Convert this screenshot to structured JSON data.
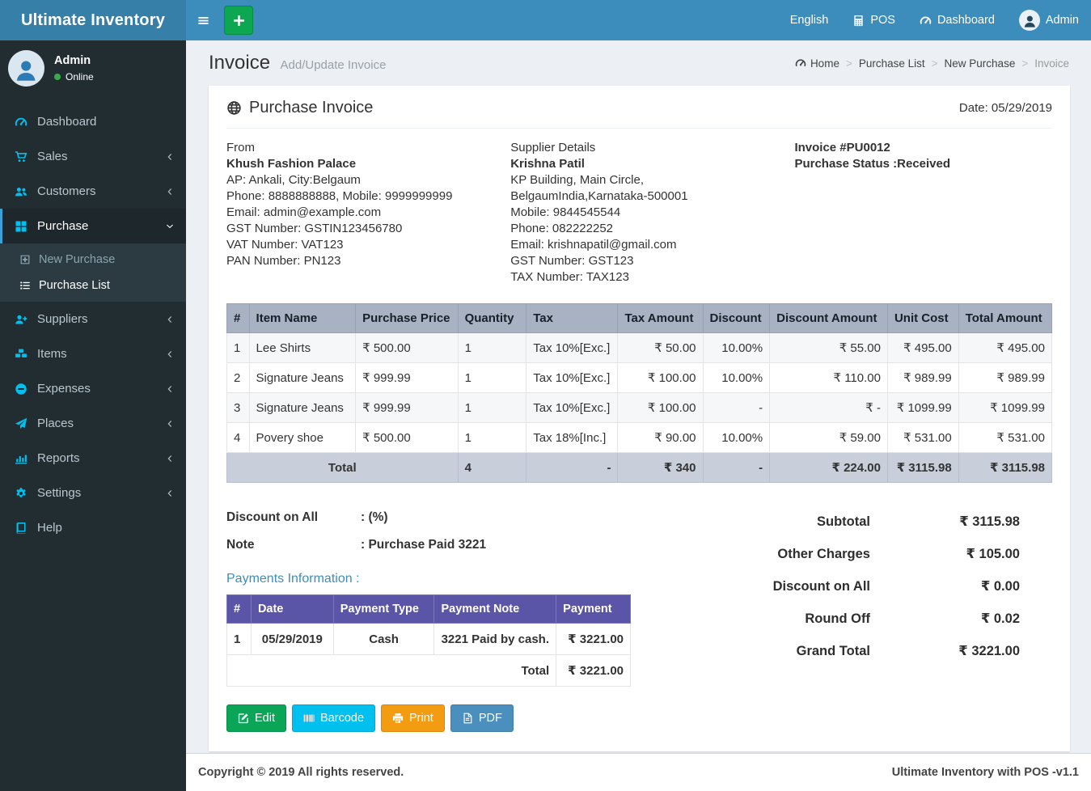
{
  "topnav": {
    "brand": "Ultimate Inventory",
    "language": "English",
    "pos": "POS",
    "dashboard": "Dashboard",
    "user": "Admin"
  },
  "sidebar": {
    "user": {
      "name": "Admin",
      "status": "Online"
    },
    "items": [
      {
        "label": "Dashboard"
      },
      {
        "label": "Sales"
      },
      {
        "label": "Customers"
      },
      {
        "label": "Purchase"
      },
      {
        "label": "New Purchase"
      },
      {
        "label": "Purchase List"
      },
      {
        "label": "Suppliers"
      },
      {
        "label": "Items"
      },
      {
        "label": "Expenses"
      },
      {
        "label": "Places"
      },
      {
        "label": "Reports"
      },
      {
        "label": "Settings"
      },
      {
        "label": "Help"
      }
    ]
  },
  "page": {
    "title": "Invoice",
    "subtitle": "Add/Update Invoice",
    "breadcrumb": [
      "Home",
      "Purchase List",
      "New Purchase",
      "Invoice"
    ]
  },
  "invoice": {
    "card_title": "Purchase Invoice",
    "date": "Date: 05/29/2019",
    "from": {
      "heading": "From",
      "name": "Khush Fashion Palace",
      "lines": [
        "AP: Ankali, City:Belgaum",
        "Phone: 8888888888, Mobile: 9999999999",
        "Email: admin@example.com",
        "GST Number: GSTIN123456780",
        "VAT Number: VAT123",
        "PAN Number: PN123"
      ]
    },
    "supplier": {
      "heading": "Supplier Details",
      "name": "Krishna Patil",
      "lines": [
        "KP Building, Main Circle, BelgaumIndia,Karnataka-500001",
        "Mobile: 9844545544",
        "Phone: 082222252",
        "Email: krishnapatil@gmail.com",
        "GST Number: GST123",
        "TAX Number: TAX123"
      ]
    },
    "meta": {
      "invoice_no": "Invoice #PU0012",
      "status": "Purchase Status :Received"
    },
    "items_table": {
      "headers": [
        "#",
        "Item Name",
        "Purchase Price",
        "Quantity",
        "Tax",
        "Tax Amount",
        "Discount",
        "Discount Amount",
        "Unit Cost",
        "Total Amount"
      ],
      "rows": [
        [
          "1",
          "Lee Shirts",
          "₹ 500.00",
          "1",
          "Tax 10%[Exc.]",
          "₹ 50.00",
          "10.00%",
          "₹ 55.00",
          "₹ 495.00",
          "₹ 495.00"
        ],
        [
          "2",
          "Signature Jeans",
          "₹ 999.99",
          "1",
          "Tax 10%[Exc.]",
          "₹ 100.00",
          "10.00%",
          "₹ 110.00",
          "₹ 989.99",
          "₹ 989.99"
        ],
        [
          "3",
          "Signature Jeans",
          "₹ 999.99",
          "1",
          "Tax 10%[Exc.]",
          "₹ 100.00",
          "-",
          "₹ -",
          "₹ 1099.99",
          "₹ 1099.99"
        ],
        [
          "4",
          "Povery shoe",
          "₹ 500.00",
          "1",
          "Tax 18%[Inc.]",
          "₹ 90.00",
          "10.00%",
          "₹ 59.00",
          "₹ 531.00",
          "₹ 531.00"
        ]
      ],
      "total_row": [
        "Total",
        "4",
        "-",
        "₹ 340",
        "-",
        "₹ 224.00",
        "₹ 3115.98",
        "₹ 3115.98"
      ]
    },
    "discount_on_all": {
      "label": "Discount on All",
      "value": ": (%)"
    },
    "note": {
      "label": "Note",
      "value": ": Purchase Paid 3221"
    },
    "payments": {
      "title": "Payments Information :",
      "headers": [
        "#",
        "Date",
        "Payment Type",
        "Payment Note",
        "Payment"
      ],
      "rows": [
        [
          "1",
          "05/29/2019",
          "Cash",
          "3221 Paid by cash.",
          "₹ 3221.00"
        ]
      ],
      "total_label": "Total",
      "total_value": "₹ 3221.00"
    },
    "summary": [
      {
        "label": "Subtotal",
        "value": "₹ 3115.98"
      },
      {
        "label": "Other Charges",
        "value": "₹ 105.00"
      },
      {
        "label": "Discount on All",
        "value": "₹ 0.00"
      },
      {
        "label": "Round Off",
        "value": "₹ 0.02"
      },
      {
        "label": "Grand Total",
        "value": "₹ 3221.00"
      }
    ],
    "actions": [
      {
        "label": "Edit"
      },
      {
        "label": "Barcode"
      },
      {
        "label": "Print"
      },
      {
        "label": "PDF"
      }
    ]
  },
  "footer": {
    "left": "Copyright © 2019 All rights reserved.",
    "right": "Ultimate Inventory with POS -v1.1"
  },
  "icons": {
    "sidebar-toggle": "hamburger-bars",
    "quick-add": "plus",
    "pos": "calculator",
    "dashboard": "gauge",
    "user": "person-avatar",
    "sales": "shopping-cart",
    "customers": "users",
    "purchase": "grid",
    "new-purchase": "plus-square",
    "purchase-list": "list",
    "suppliers": "user-plus",
    "items": "cubes",
    "expenses": "minus-circle",
    "places": "paper-plane",
    "reports": "bar-chart",
    "settings": "gear",
    "help": "book",
    "card-title": "globe",
    "edit": "pencil-square",
    "barcode": "barcode",
    "print": "printer",
    "pdf": "file-pdf"
  },
  "colors": {
    "navbar": "#3c8dbc",
    "logo": "#367fa9",
    "sidebar": "#222d32",
    "sidebar_active": "#1e282c",
    "submenu": "#2c3b41",
    "icon_accent": "#00c0ef",
    "content_bg": "#ecf0f5",
    "table_header": "#a9b2c2",
    "table_total": "#c9cedb",
    "payments_header": "#5b55a7",
    "success": "#0ba558",
    "info": "#00c0ef",
    "warning": "#f39c12",
    "primary": "#3c8dbc"
  }
}
